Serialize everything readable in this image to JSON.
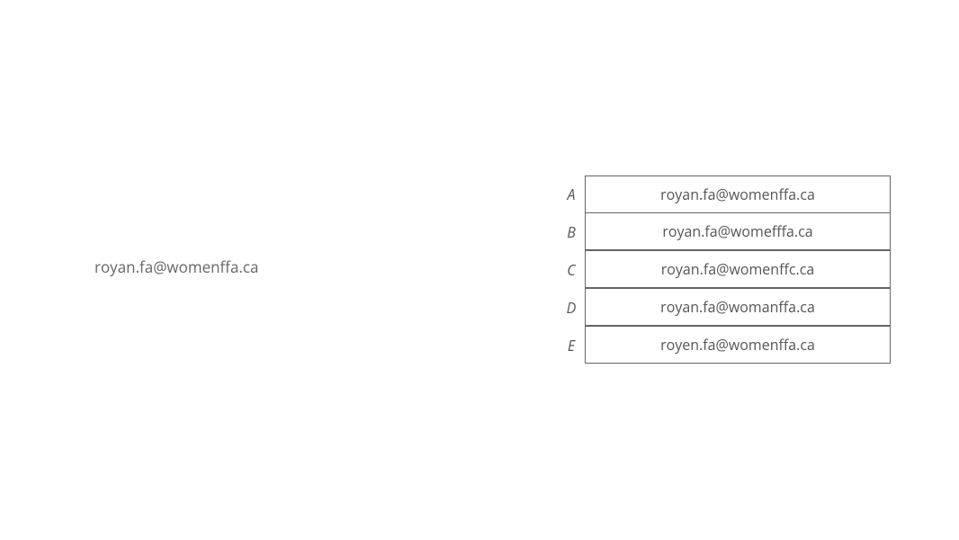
{
  "prompt": "royan.fa@womenffa.ca",
  "options": [
    {
      "letter": "A",
      "text": "royan.fa@womenffa.ca"
    },
    {
      "letter": "B",
      "text": "royan.fa@womefffa.ca"
    },
    {
      "letter": "C",
      "text": "royan.fa@womenffc.ca"
    },
    {
      "letter": "D",
      "text": "royan.fa@womanffa.ca"
    },
    {
      "letter": "E",
      "text": "royen.fa@womenffa.ca"
    }
  ]
}
